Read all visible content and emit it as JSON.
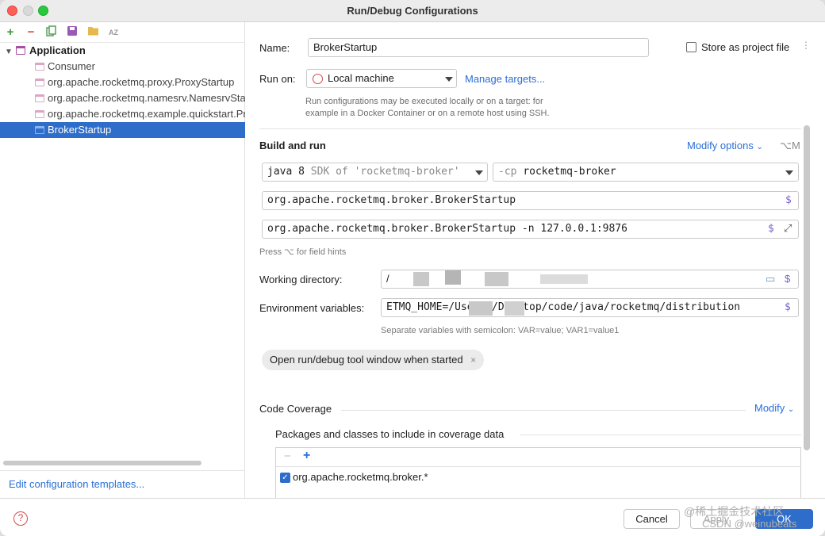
{
  "window": {
    "title": "Run/Debug Configurations"
  },
  "sidebar": {
    "toolbar": [
      "add-icon",
      "remove-icon",
      "copy-icon",
      "save-icon",
      "folder-icon",
      "sort-icon"
    ],
    "group": "Application",
    "items": [
      {
        "label": "Consumer",
        "selected": false
      },
      {
        "label": "org.apache.rocketmq.proxy.ProxyStartup",
        "selected": false
      },
      {
        "label": "org.apache.rocketmq.namesrv.NamesrvStartup",
        "selected": false
      },
      {
        "label": "org.apache.rocketmq.example.quickstart.Producer",
        "selected": false
      },
      {
        "label": "BrokerStartup",
        "selected": true
      }
    ],
    "edit_templates": "Edit configuration templates..."
  },
  "form": {
    "name_label": "Name:",
    "name_value": "BrokerStartup",
    "store_label": "Store as project file",
    "run_on_label": "Run on:",
    "run_on_value": "Local machine",
    "manage_targets": "Manage targets...",
    "run_hint_1": "Run configurations may be executed locally or on a target: for",
    "run_hint_2": "example in a Docker Container or on a remote host using SSH.",
    "build_run": "Build and run",
    "modify_options": "Modify options",
    "modify_shortcut": "⌥M",
    "sdk_main": "java 8",
    "sdk_sub": "SDK of 'rocketmq-broker'",
    "cp_flag": "-cp",
    "cp_value": "rocketmq-broker",
    "main_class": "org.apache.rocketmq.broker.BrokerStartup",
    "program_args": "org.apache.rocketmq.broker.BrokerStartup -n 127.0.0.1:9876",
    "field_hints": "Press ⌥ for field hints",
    "working_dir_label": "Working directory:",
    "working_dir_value": "/",
    "env_label": "Environment variables:",
    "env_value": "ETMQ_HOME=/Use   /   /Desktop/code/java/rocketmq/distribution",
    "env_hint": "Separate variables with semicolon: VAR=value; VAR1=value1",
    "chip_label": "Open run/debug tool window when started",
    "coverage_title": "Code Coverage",
    "coverage_modify": "Modify",
    "coverage_packages": "Packages and classes to include in coverage data",
    "coverage_item": "org.apache.rocketmq.broker.*"
  },
  "footer": {
    "cancel": "Cancel",
    "apply": "Apply",
    "ok": "OK",
    "watermark_1": "@稀土掘金技术社区",
    "watermark_2": "CSDN @weinubeats"
  }
}
